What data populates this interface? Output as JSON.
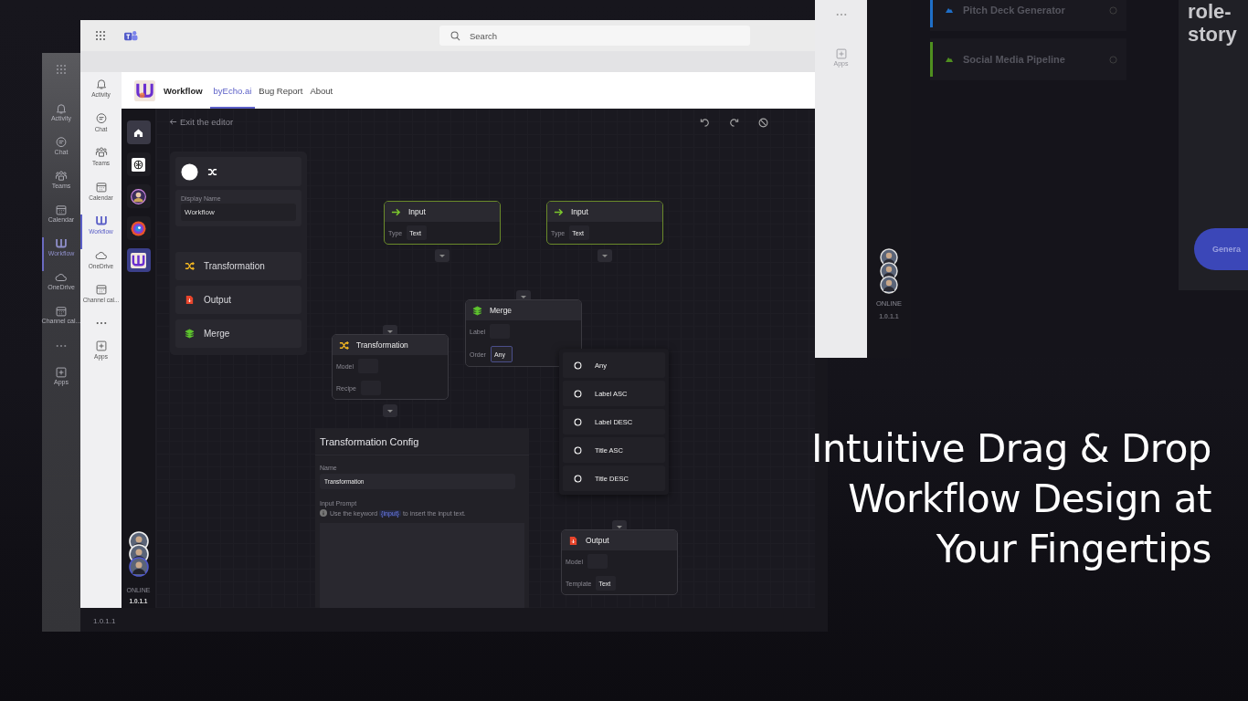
{
  "back_window": {
    "rail_items": [
      {
        "label": "Activity",
        "selected": false
      },
      {
        "label": "Chat",
        "selected": false
      },
      {
        "label": "Teams",
        "selected": false
      },
      {
        "label": "Calendar",
        "selected": false
      },
      {
        "label": "Workflow",
        "selected": true
      },
      {
        "label": "OneDrive",
        "selected": false
      },
      {
        "label": "Channel cal...",
        "selected": false
      },
      {
        "label": "Apps",
        "selected": false
      }
    ],
    "version": "1.0.1.1"
  },
  "main_window": {
    "search": {
      "placeholder": "Search"
    },
    "rail_items": [
      {
        "label": "Activity",
        "selected": false
      },
      {
        "label": "Chat",
        "selected": false
      },
      {
        "label": "Teams",
        "selected": false
      },
      {
        "label": "Calendar",
        "selected": false
      },
      {
        "label": "Workflow",
        "selected": true
      },
      {
        "label": "OneDrive",
        "selected": false
      },
      {
        "label": "Channel cal...",
        "selected": false
      },
      {
        "label": "Apps",
        "selected": false
      }
    ],
    "app": {
      "name": "Workflow",
      "tabs": [
        {
          "label": "byEcho.ai",
          "selected": true
        },
        {
          "label": "Bug Report",
          "selected": false
        },
        {
          "label": "About",
          "selected": false
        }
      ]
    },
    "app_rail": {
      "items": [
        {
          "kind": "home",
          "selected": false
        },
        {
          "kind": "knot",
          "selected": false
        },
        {
          "kind": "avatar",
          "selected": false
        },
        {
          "kind": "swirl",
          "selected": false
        },
        {
          "kind": "logo",
          "selected": true
        }
      ],
      "status": "ONLINE",
      "version": "1.0.1.1"
    },
    "editor": {
      "exit_link": "Exit the editor",
      "node_panel": {
        "display_name_label": "Display Name",
        "display_name": "Workflow",
        "items": [
          {
            "label": "Transformation",
            "kind": "transformation"
          },
          {
            "label": "Output",
            "kind": "output"
          },
          {
            "label": "Merge",
            "kind": "merge"
          }
        ]
      },
      "nodes": [
        {
          "kind": "input",
          "title": "Input",
          "fields": [
            {
              "label": "Type",
              "value": "Text",
              "focused": false
            }
          ]
        },
        {
          "kind": "input",
          "title": "Input",
          "fields": [
            {
              "label": "Type",
              "value": "Text",
              "focused": false
            }
          ]
        },
        {
          "kind": "merge",
          "title": "Merge",
          "fields": [
            {
              "label": "Label",
              "focused": false
            },
            {
              "label": "Order",
              "value": "Any",
              "focused": true
            }
          ]
        },
        {
          "kind": "transformation",
          "title": "Transformation",
          "fields": [
            {
              "label": "Model",
              "focused": false
            },
            {
              "label": "Recipe",
              "focused": false
            }
          ]
        },
        {
          "kind": "output",
          "title": "Output",
          "fields": [
            {
              "label": "Model",
              "focused": false
            },
            {
              "label": "Template",
              "value": "Text",
              "focused": false
            }
          ]
        }
      ],
      "order_menu": {
        "options": [
          {
            "label": "Any",
            "selected": false
          },
          {
            "label": "Label ASC",
            "selected": false
          },
          {
            "label": "Label DESC",
            "selected": false
          },
          {
            "label": "Title ASC",
            "selected": false
          },
          {
            "label": "Title DESC",
            "selected": false
          }
        ]
      },
      "config": {
        "title": "Transformation Config",
        "name_label": "Name",
        "name": "Transformation",
        "prompt_label": "Input Prompt",
        "hint_before": "Use the keyword",
        "keyword": "{input}",
        "hint_after": "to insert the input text."
      }
    }
  },
  "right_window": {
    "apps_label": "Apps",
    "status": "ONLINE",
    "version": "1.0.1.1",
    "list": [
      {
        "label": "Pitch Deck Generator",
        "color": "#1f6fc8"
      },
      {
        "label": "Social Media Pipeline",
        "color": "#4f8f1f"
      }
    ],
    "preview_lines": [
      "role-",
      "story"
    ],
    "button": "Genera"
  },
  "headline": [
    "Intuitive Drag & Drop",
    "Workflow Design at",
    "Your Fingertips"
  ]
}
